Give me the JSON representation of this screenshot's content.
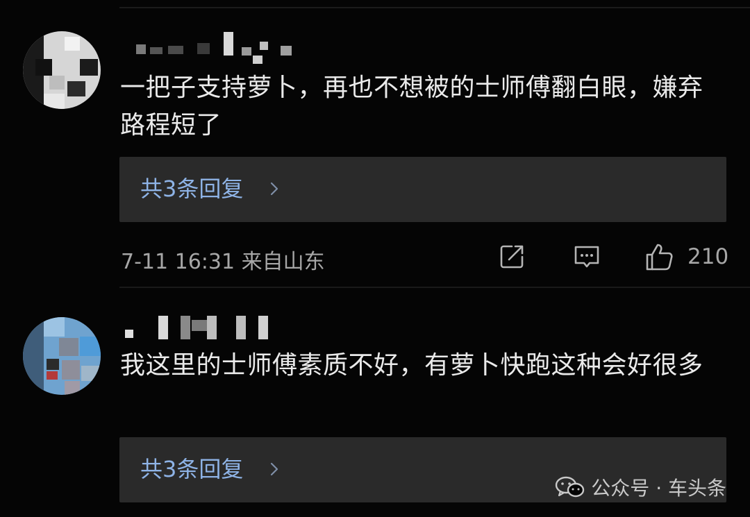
{
  "comments": [
    {
      "text": "一把子支持萝卜，再也不想被的士师傅翻白眼，嫌弃路程短了",
      "replies_label": "共3条回复",
      "timestamp": "7-11 16:31 来自山东",
      "like_count": "210"
    },
    {
      "text": "我这里的士师傅素质不好，有萝卜快跑这种会好很多",
      "replies_label": "共3条回复"
    }
  ],
  "icons": {
    "chevron": "chevron-right-icon",
    "share": "share-icon",
    "reply": "comment-reply-icon",
    "like": "thumbs-up-icon",
    "watermark": "wechat-icon"
  },
  "colors": {
    "background": "#050505",
    "reply_box": "#2a2a2a",
    "reply_link": "#8eb3e6",
    "secondary_text": "#a7a7a7"
  },
  "watermark": {
    "text": "公众号 · 车头条"
  }
}
